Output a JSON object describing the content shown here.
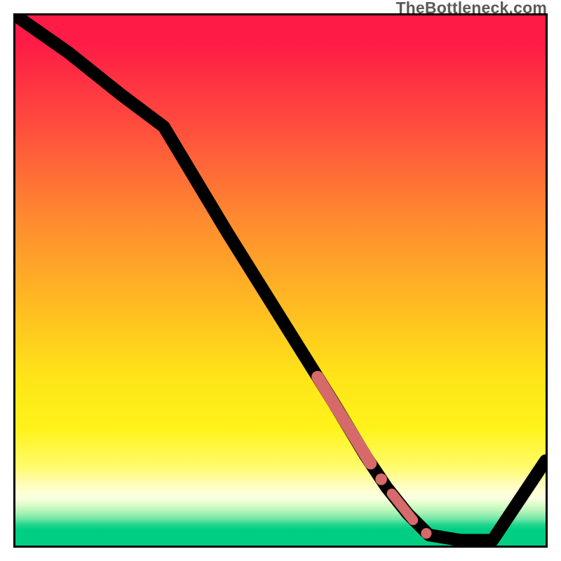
{
  "watermark": {
    "text": "TheBottleneck.com"
  },
  "colors": {
    "curve": "#000000",
    "marker": "#d66a6a",
    "gradient_top": "#fe1b46",
    "gradient_mid": "#fee418",
    "gradient_bottom": "#00cf83"
  },
  "chart_data": {
    "type": "line",
    "title": "",
    "xlabel": "",
    "ylabel": "",
    "xlim": [
      0,
      100
    ],
    "ylim": [
      0,
      100
    ],
    "grid": false,
    "legend": false,
    "annotations": [
      "TheBottleneck.com"
    ],
    "series": [
      {
        "name": "bottleneck-curve",
        "x": [
          0,
          10,
          20,
          28,
          40,
          50,
          60,
          66,
          70,
          74,
          78,
          84,
          90,
          100
        ],
        "y": [
          100,
          93,
          85,
          79,
          59,
          43,
          27,
          17,
          11,
          6,
          2,
          1,
          1,
          16
        ]
      }
    ],
    "markers": {
      "name": "highlighted-segment",
      "on_series": "bottleneck-curve",
      "style": "thick-dots",
      "color": "#d66a6a",
      "segments": [
        {
          "x_start": 57,
          "x_end": 67,
          "thickness": "heavy"
        },
        {
          "x_start": 68,
          "x_end": 70,
          "thickness": "dot"
        },
        {
          "x_start": 71,
          "x_end": 75,
          "thickness": "medium"
        },
        {
          "x_start": 77,
          "x_end": 78,
          "thickness": "dot"
        }
      ]
    }
  }
}
